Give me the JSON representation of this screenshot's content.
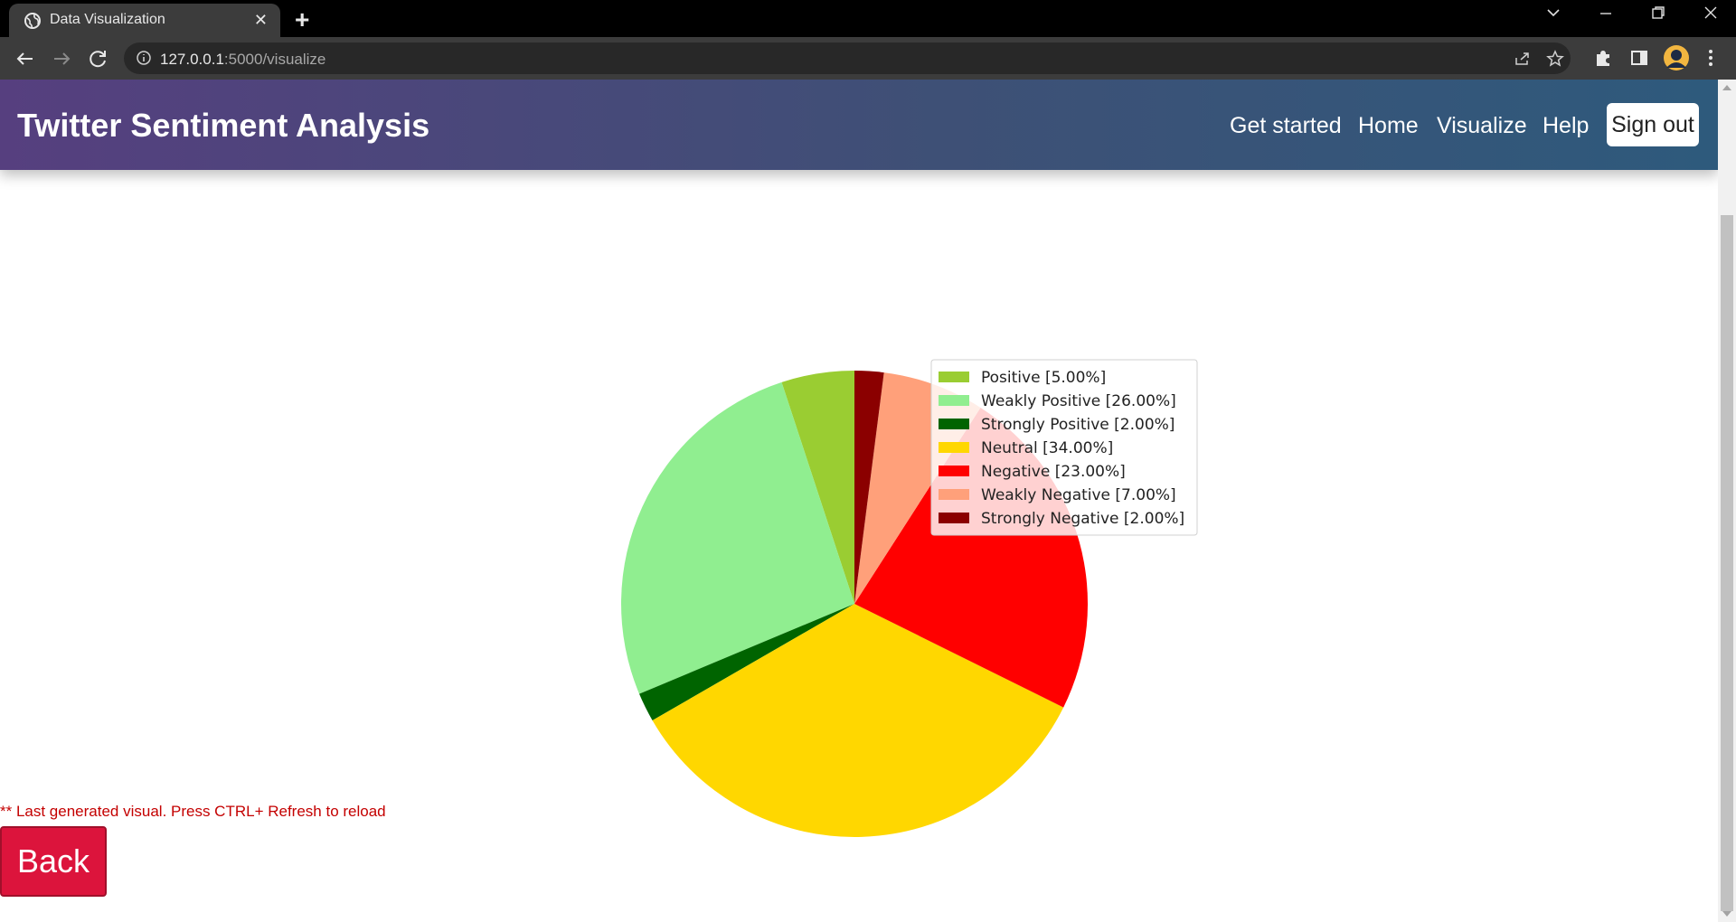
{
  "browser": {
    "tab_title": "Data Visualization",
    "url_host": "127.0.0.1",
    "url_path": ":5000/visualize",
    "icons": [
      "globe-icon",
      "close-icon",
      "plus-icon",
      "back-arrow-icon",
      "forward-arrow-icon",
      "reload-icon",
      "info-icon",
      "share-icon",
      "star-icon",
      "puzzle-icon",
      "side-panel-icon",
      "avatar",
      "kebab-menu-icon",
      "chevron-down-icon",
      "minimize-icon",
      "restore-icon",
      "window-close-icon"
    ]
  },
  "header": {
    "brand": "Twitter Sentiment Analysis",
    "nav": {
      "get_started": "Get started",
      "home": "Home",
      "visualize": "Visualize",
      "help": "Help",
      "sign_out": "Sign out"
    },
    "gradient": [
      "#563f7f",
      "#2e5a7c"
    ]
  },
  "chart_data": {
    "type": "pie",
    "title": "",
    "legend_position": "top-right",
    "start_angle_deg": 90,
    "direction": "counterclockwise",
    "slices": [
      {
        "label": "Positive [5.00%]",
        "value": 5.0,
        "color": "#9acd32"
      },
      {
        "label": "Weakly Positive [26.00%]",
        "value": 26.0,
        "color": "#90ee90"
      },
      {
        "label": "Strongly Positive [2.00%]",
        "value": 2.0,
        "color": "#006400"
      },
      {
        "label": "Neutral [34.00%]",
        "value": 34.0,
        "color": "#ffd700"
      },
      {
        "label": "Negative [23.00%]",
        "value": 23.0,
        "color": "#ff0000"
      },
      {
        "label": "Weakly Negative [7.00%]",
        "value": 7.0,
        "color": "#ffa07a"
      },
      {
        "label": "Strongly Negative [2.00%]",
        "value": 2.0,
        "color": "#8b0000"
      }
    ]
  },
  "footer": {
    "note": "** Last generated visual. Press CTRL+ Refresh to reload",
    "back_label": "Back",
    "note_color": "#c40000",
    "back_color": "#dc143c"
  }
}
